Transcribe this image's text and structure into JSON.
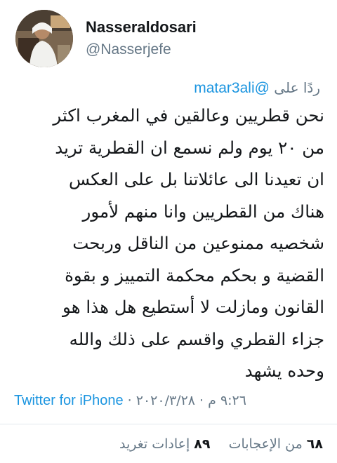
{
  "user": {
    "display_name": "Nasseraldosari",
    "handle": "@Nasserjefe"
  },
  "reply": {
    "prefix": "ردًا على",
    "mention": "@matar3ali"
  },
  "tweet": {
    "lines": [
      "نحن قطريين وعالقين في المغرب اكثر",
      "من ٢٠ يوم ولم نسمع ان القطرية تريد",
      "ان تعيدنا الى عائلاتنا بل على العكس",
      "هناك من القطريين وانا منهم لأمور",
      "شخصيه ممنوعين من الناقل وربحت",
      "القضية و بحكم محكمة التمييز و بقوة",
      "القانون ومازلت لا أستطيع هل هذا هو",
      "جزاء القطري واقسم على ذلك والله",
      "وحده يشهد"
    ]
  },
  "meta": {
    "source": "Twitter for iPhone",
    "separator": " · ",
    "date": "٢٠٢٠/٣/٢٨",
    "time": "٩:٢٦ م"
  },
  "stats": {
    "retweets_count": "٨٩",
    "retweets_label": "إعادات تغريد",
    "likes_count": "٦٨",
    "likes_label": "من الإعجابات"
  },
  "colors": {
    "link": "#1b95e0",
    "secondary_text": "#657786",
    "primary_text": "#14171a",
    "divider": "#e1e8ed"
  }
}
